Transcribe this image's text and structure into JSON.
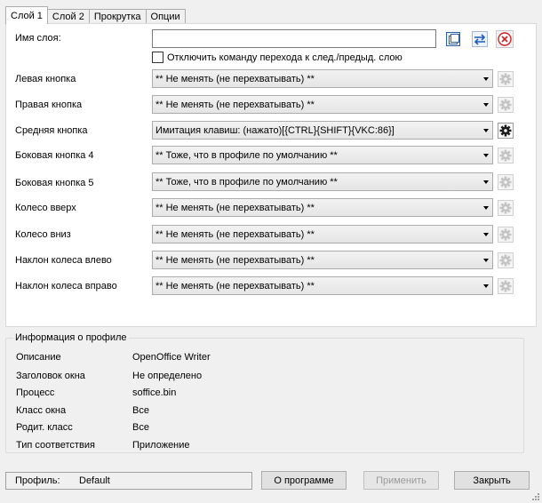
{
  "tabs": [
    "Слой 1",
    "Слой 2",
    "Прокрутка",
    "Опции"
  ],
  "layer": {
    "name_label": "Имя слоя:",
    "name_value": "",
    "disable_switch_label": "Отключить команду перехода к след./предыд. слою"
  },
  "buttons_rows": [
    {
      "label": "Левая кнопка",
      "value": "** Не менять (не перехватывать) **"
    },
    {
      "label": "Правая кнопка",
      "value": "** Не менять (не перехватывать) **"
    },
    {
      "label": "Средняя кнопка",
      "value": "Имитация клавиш: (нажато)[{CTRL}{SHIFT}{VKC:86}]"
    },
    {
      "label": "Боковая кнопка 4",
      "value": "** Тоже, что в профиле по умолчанию **"
    },
    {
      "label": "Боковая кнопка 5",
      "value": "** Тоже, что в профиле по умолчанию **"
    },
    {
      "label": "Колесо вверх",
      "value": "** Не менять (не перехватывать) **"
    },
    {
      "label": "Колесо вниз",
      "value": "** Не менять (не перехватывать) **"
    },
    {
      "label": "Наклон колеса влево",
      "value": "** Не менять (не перехватывать) **"
    },
    {
      "label": "Наклон колеса вправо",
      "value": "** Не менять (не перехватывать) **"
    }
  ],
  "profile_info": {
    "title": "Информация о профиле",
    "rows": [
      {
        "key": "Описание",
        "value": "OpenOffice Writer"
      },
      {
        "key": "Заголовок окна",
        "value": "Не определено"
      },
      {
        "key": "Процесс",
        "value": "soffice.bin"
      },
      {
        "key": "Класс окна",
        "value": "Все"
      },
      {
        "key": "Родит. класс",
        "value": "Все"
      },
      {
        "key": "Тип соответствия",
        "value": "Приложение"
      }
    ]
  },
  "status": {
    "profile_label": "Профиль:",
    "profile_value": "Default"
  },
  "footer": {
    "about": "О программе",
    "apply": "Применить",
    "close": "Закрыть"
  },
  "icons": {
    "copy": "copy-icon",
    "swap": "swap-arrows-icon",
    "delete": "delete-icon",
    "gear": "gear-icon"
  }
}
